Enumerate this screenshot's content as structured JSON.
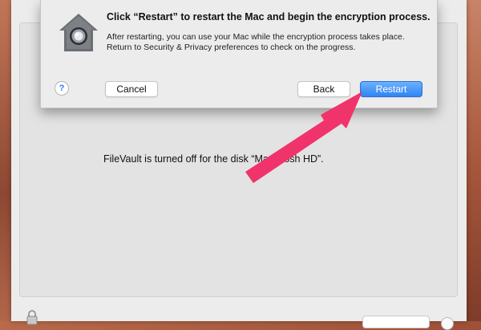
{
  "sheet": {
    "title": "Click “Restart” to restart the Mac and begin the encryption process.",
    "message_line1": "After restarting, you can use your Mac while the encryption process takes place.",
    "message_line2": "Return to Security & Privacy preferences to check on the progress.",
    "help_label": "?",
    "cancel_label": "Cancel",
    "back_label": "Back",
    "restart_label": "Restart"
  },
  "panel": {
    "status_text": "FileVault is turned off for the disk “Macintosh HD”."
  },
  "icons": {
    "sheet_icon": "security-house-icon",
    "lock": "lock-icon",
    "annotation": "pink-arrow-annotation"
  },
  "colors": {
    "restart_button": "#2f86f3",
    "annotation_arrow": "#f0336b",
    "help_glyph": "#2a7df0"
  }
}
